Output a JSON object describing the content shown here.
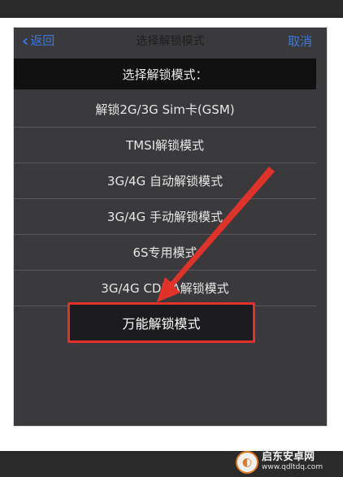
{
  "nav": {
    "back_label": "返回",
    "title": "选择解锁模式",
    "cancel_label": "取消"
  },
  "menu": {
    "header": "选择解锁模式：",
    "items": [
      "解锁2G/3G Sim卡(GSM)",
      "TMSI解锁模式",
      "3G/4G 自动解锁模式",
      "3G/4G 手动解锁模式",
      "6S专用模式",
      "3G/4G CDMA解锁模式"
    ],
    "highlighted_item": "万能解锁模式"
  },
  "annotation": {
    "arrow_color": "#e0322a",
    "box_color": "#e0322a"
  },
  "watermark": {
    "name": "启东安卓网",
    "url": "www.qdltdq.com"
  }
}
